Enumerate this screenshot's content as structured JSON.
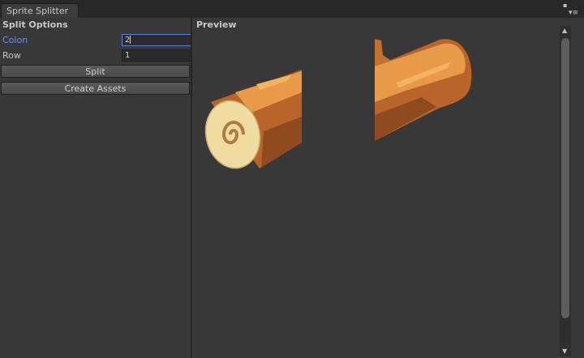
{
  "window": {
    "tab_title": "Sprite Splitter",
    "maximize_icon": "maximize-icon",
    "menu_icon": "menu-icon"
  },
  "options": {
    "header": "Split Options",
    "colon_label": "Colon",
    "colon_value": "2",
    "row_label": "Row",
    "row_value": "1",
    "split_button": "Split",
    "create_button": "Create Assets"
  },
  "preview": {
    "header": "Preview",
    "pieces": [
      "log-left-half",
      "log-right-half"
    ]
  },
  "colors": {
    "focus": "#5a82d8",
    "label_active": "#6a8ff0",
    "wood": "#b8642a",
    "wood_light": "#e89a48",
    "cut": "#f0dca0"
  }
}
